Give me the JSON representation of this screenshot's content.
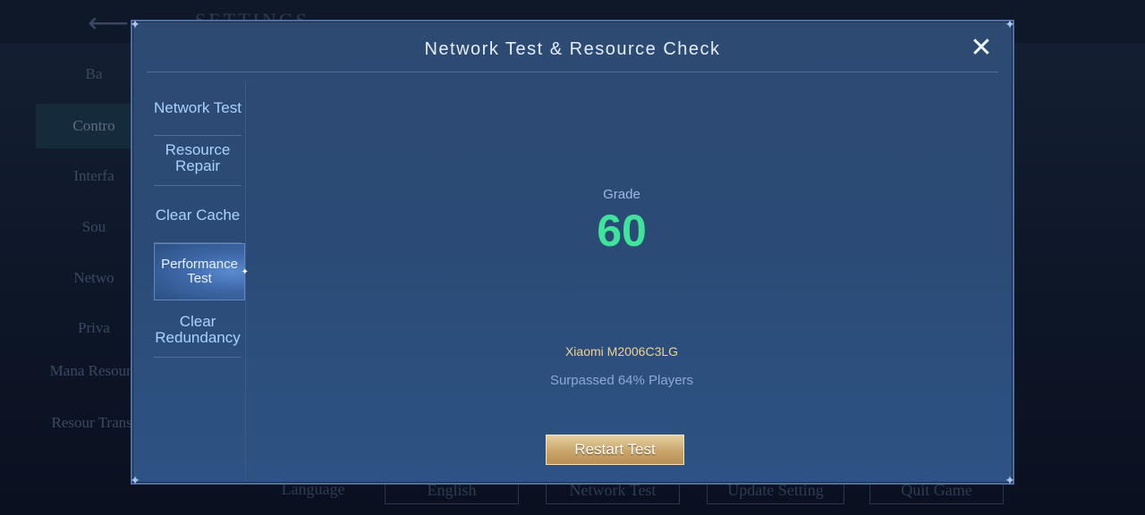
{
  "background": {
    "title": "SETTINGS",
    "sidebar": [
      "Ba",
      "Contro",
      "Interfa",
      "Sou",
      "Netwo",
      "Priva",
      "Mana Resourc",
      "Resour Transl"
    ],
    "bottom_buttons": [
      "Language",
      "English",
      "Network Test",
      "Update Setting",
      "Quit Game"
    ]
  },
  "modal": {
    "title": "Network Test & Resource Check",
    "close_icon": "close-x-icon",
    "nav": [
      {
        "label": "Network Test"
      },
      {
        "label": "Resource Repair"
      },
      {
        "label": "Clear Cache"
      },
      {
        "label": "Performance Test",
        "active": true
      },
      {
        "label": "Clear Redundancy"
      }
    ],
    "result": {
      "grade_label": "Grade",
      "grade_value": "60",
      "device": "Xiaomi M2006C3LG",
      "surpassed": "Surpassed 64% Players"
    },
    "restart_label": "Restart Test"
  },
  "colors": {
    "accent_green": "#3fe39a",
    "nav_text": "#a9d3ff",
    "device_gold": "#f0d28e",
    "button_gold": "#c9a66b"
  }
}
